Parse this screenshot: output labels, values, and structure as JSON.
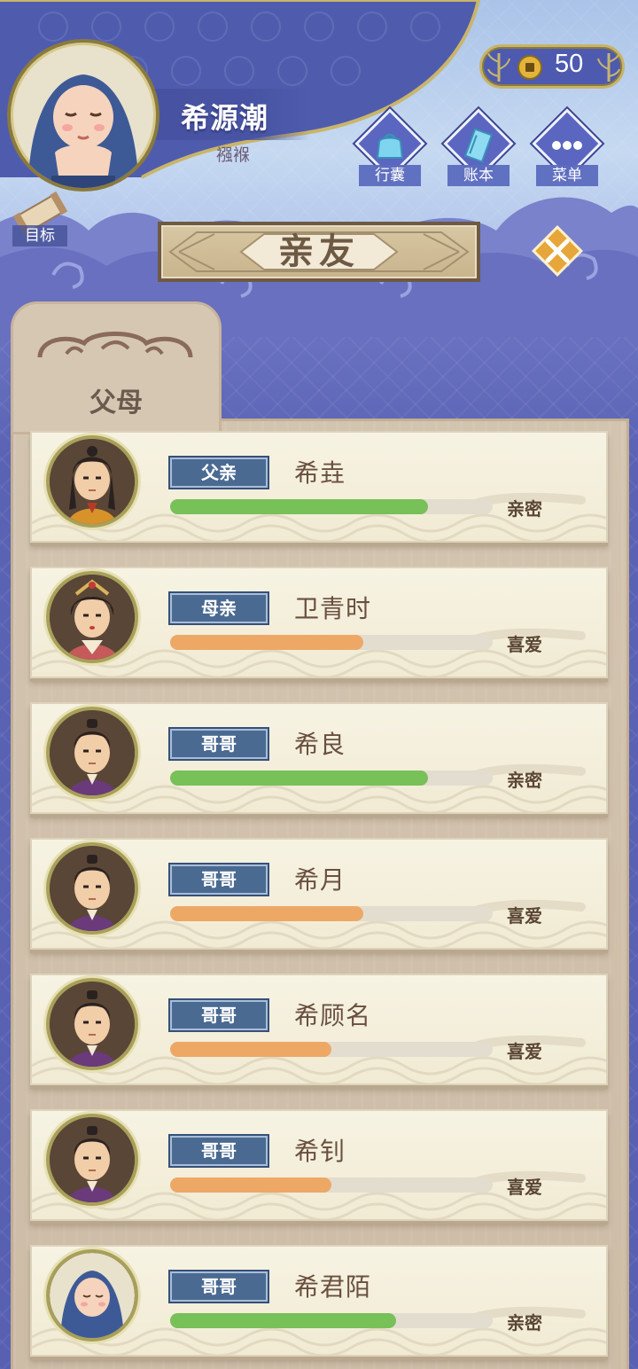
{
  "player": {
    "name": "希源潮",
    "age_stage": "襁褓"
  },
  "goal": {
    "label": "目标"
  },
  "currency": {
    "icon": "coin-icon",
    "value": "50"
  },
  "actions": [
    {
      "label": "行囊",
      "icon": "bag-icon"
    },
    {
      "label": "账本",
      "icon": "ledger-icon"
    },
    {
      "label": "菜单",
      "icon": "more-icon"
    }
  ],
  "title": "亲友",
  "tab": {
    "label": "父母"
  },
  "relatives": [
    {
      "relation": "父亲",
      "name": "希垚",
      "status": "亲密",
      "affinity": 0.8,
      "bar_color": "green",
      "avatar": "father-avatar"
    },
    {
      "relation": "母亲",
      "name": "卫青时",
      "status": "喜爱",
      "affinity": 0.6,
      "bar_color": "orange",
      "avatar": "mother-avatar"
    },
    {
      "relation": "哥哥",
      "name": "希良",
      "status": "亲密",
      "affinity": 0.8,
      "bar_color": "green",
      "avatar": "brother-avatar"
    },
    {
      "relation": "哥哥",
      "name": "希月",
      "status": "喜爱",
      "affinity": 0.6,
      "bar_color": "orange",
      "avatar": "brother-avatar"
    },
    {
      "relation": "哥哥",
      "name": "希顾名",
      "status": "喜爱",
      "affinity": 0.5,
      "bar_color": "orange",
      "avatar": "brother-avatar"
    },
    {
      "relation": "哥哥",
      "name": "希钊",
      "status": "喜爱",
      "affinity": 0.5,
      "bar_color": "orange",
      "avatar": "brother-avatar"
    },
    {
      "relation": "哥哥",
      "name": "希君陌",
      "status": "亲密",
      "affinity": 0.7,
      "bar_color": "green",
      "avatar": "baby-avatar"
    }
  ],
  "colors": {
    "bar_green": "#78c058",
    "bar_orange": "#eea866",
    "relation_badge": "#4a6a92",
    "sky": "#5a62b4"
  }
}
